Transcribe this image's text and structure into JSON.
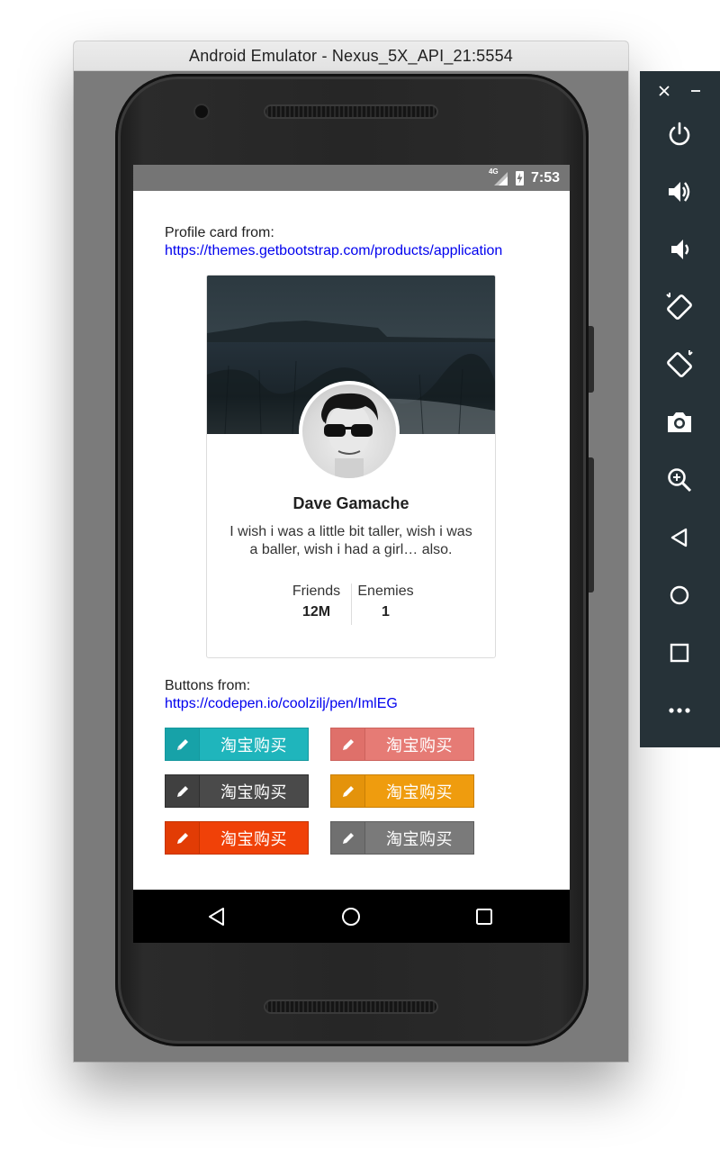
{
  "window": {
    "title": "Android Emulator - Nexus_5X_API_21:5554"
  },
  "status_bar": {
    "network": "4G",
    "time": "7:53"
  },
  "profile_section": {
    "label": "Profile card from:",
    "link": "https://themes.getbootstrap.com/products/application"
  },
  "card": {
    "name": "Dave Gamache",
    "bio": "I wish i was a little bit taller, wish i was a baller, wish i had a girl… also.",
    "stats": [
      {
        "label": "Friends",
        "value": "12M"
      },
      {
        "label": "Enemies",
        "value": "1"
      }
    ]
  },
  "buttons_section": {
    "label": "Buttons from:",
    "link": "https://codepen.io/coolzilj/pen/ImlEG"
  },
  "buttons": [
    {
      "label": "淘宝购买",
      "color": "#1fb5bc",
      "icon_bg": "#17a2a8",
      "border": "#15989e",
      "icon": "pencil-icon"
    },
    {
      "label": "淘宝购买",
      "color": "#e67b75",
      "icon_bg": "#df706a",
      "border": "#cc625c",
      "icon": "pencil-icon"
    },
    {
      "label": "淘宝购买",
      "color": "#4a4a4a",
      "icon_bg": "#404040",
      "border": "#2f2f2f",
      "icon": "pencil-icon"
    },
    {
      "label": "淘宝购买",
      "color": "#ef9c0e",
      "icon_bg": "#e4930b",
      "border": "#c97f04",
      "icon": "pencil-icon"
    },
    {
      "label": "淘宝购买",
      "color": "#f04108",
      "icon_bg": "#e23c05",
      "border": "#c53300",
      "icon": "pencil-icon"
    },
    {
      "label": "淘宝购买",
      "color": "#7a7a7a",
      "icon_bg": "#707070",
      "border": "#5e5e5e",
      "icon": "pencil-icon"
    }
  ],
  "nav_bar": {
    "buttons": [
      "back-icon",
      "home-icon",
      "recents-icon"
    ]
  },
  "side_panel": {
    "controls": [
      "close-icon",
      "minimize-icon"
    ],
    "buttons": [
      "power-icon",
      "volume-up-icon",
      "volume-down-icon",
      "rotate-left-icon",
      "rotate-right-icon",
      "camera-icon",
      "zoom-icon",
      "back-icon",
      "home-icon",
      "overview-icon",
      "more-icon"
    ]
  }
}
